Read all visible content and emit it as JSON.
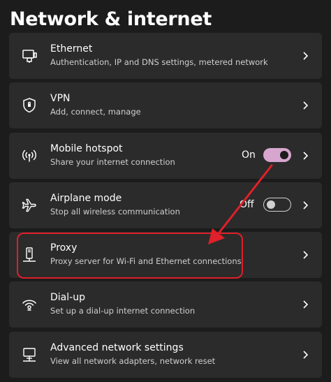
{
  "page": {
    "title": "Network & internet"
  },
  "items": [
    {
      "title": "Ethernet",
      "subtitle": "Authentication, IP and DNS settings, metered network",
      "icon": "ethernet-icon"
    },
    {
      "title": "VPN",
      "subtitle": "Add, connect, manage",
      "icon": "shield-icon"
    },
    {
      "title": "Mobile hotspot",
      "subtitle": "Share your internet connection",
      "icon": "hotspot-icon",
      "toggle": {
        "label": "On",
        "state": "on"
      }
    },
    {
      "title": "Airplane mode",
      "subtitle": "Stop all wireless communication",
      "icon": "airplane-icon",
      "toggle": {
        "label": "Off",
        "state": "off"
      }
    },
    {
      "title": "Proxy",
      "subtitle": "Proxy server for Wi-Fi and Ethernet connections",
      "icon": "proxy-icon"
    },
    {
      "title": "Dial-up",
      "subtitle": "Set up a dial-up internet connection",
      "icon": "dialup-icon"
    },
    {
      "title": "Advanced network settings",
      "subtitle": "View all network adapters, network reset",
      "icon": "monitor-network-icon"
    }
  ],
  "colors": {
    "background": "#1c1c1c",
    "card": "#2b2b2b",
    "toggle_on": "#d7a6cf",
    "annotation": "#e0202a"
  }
}
